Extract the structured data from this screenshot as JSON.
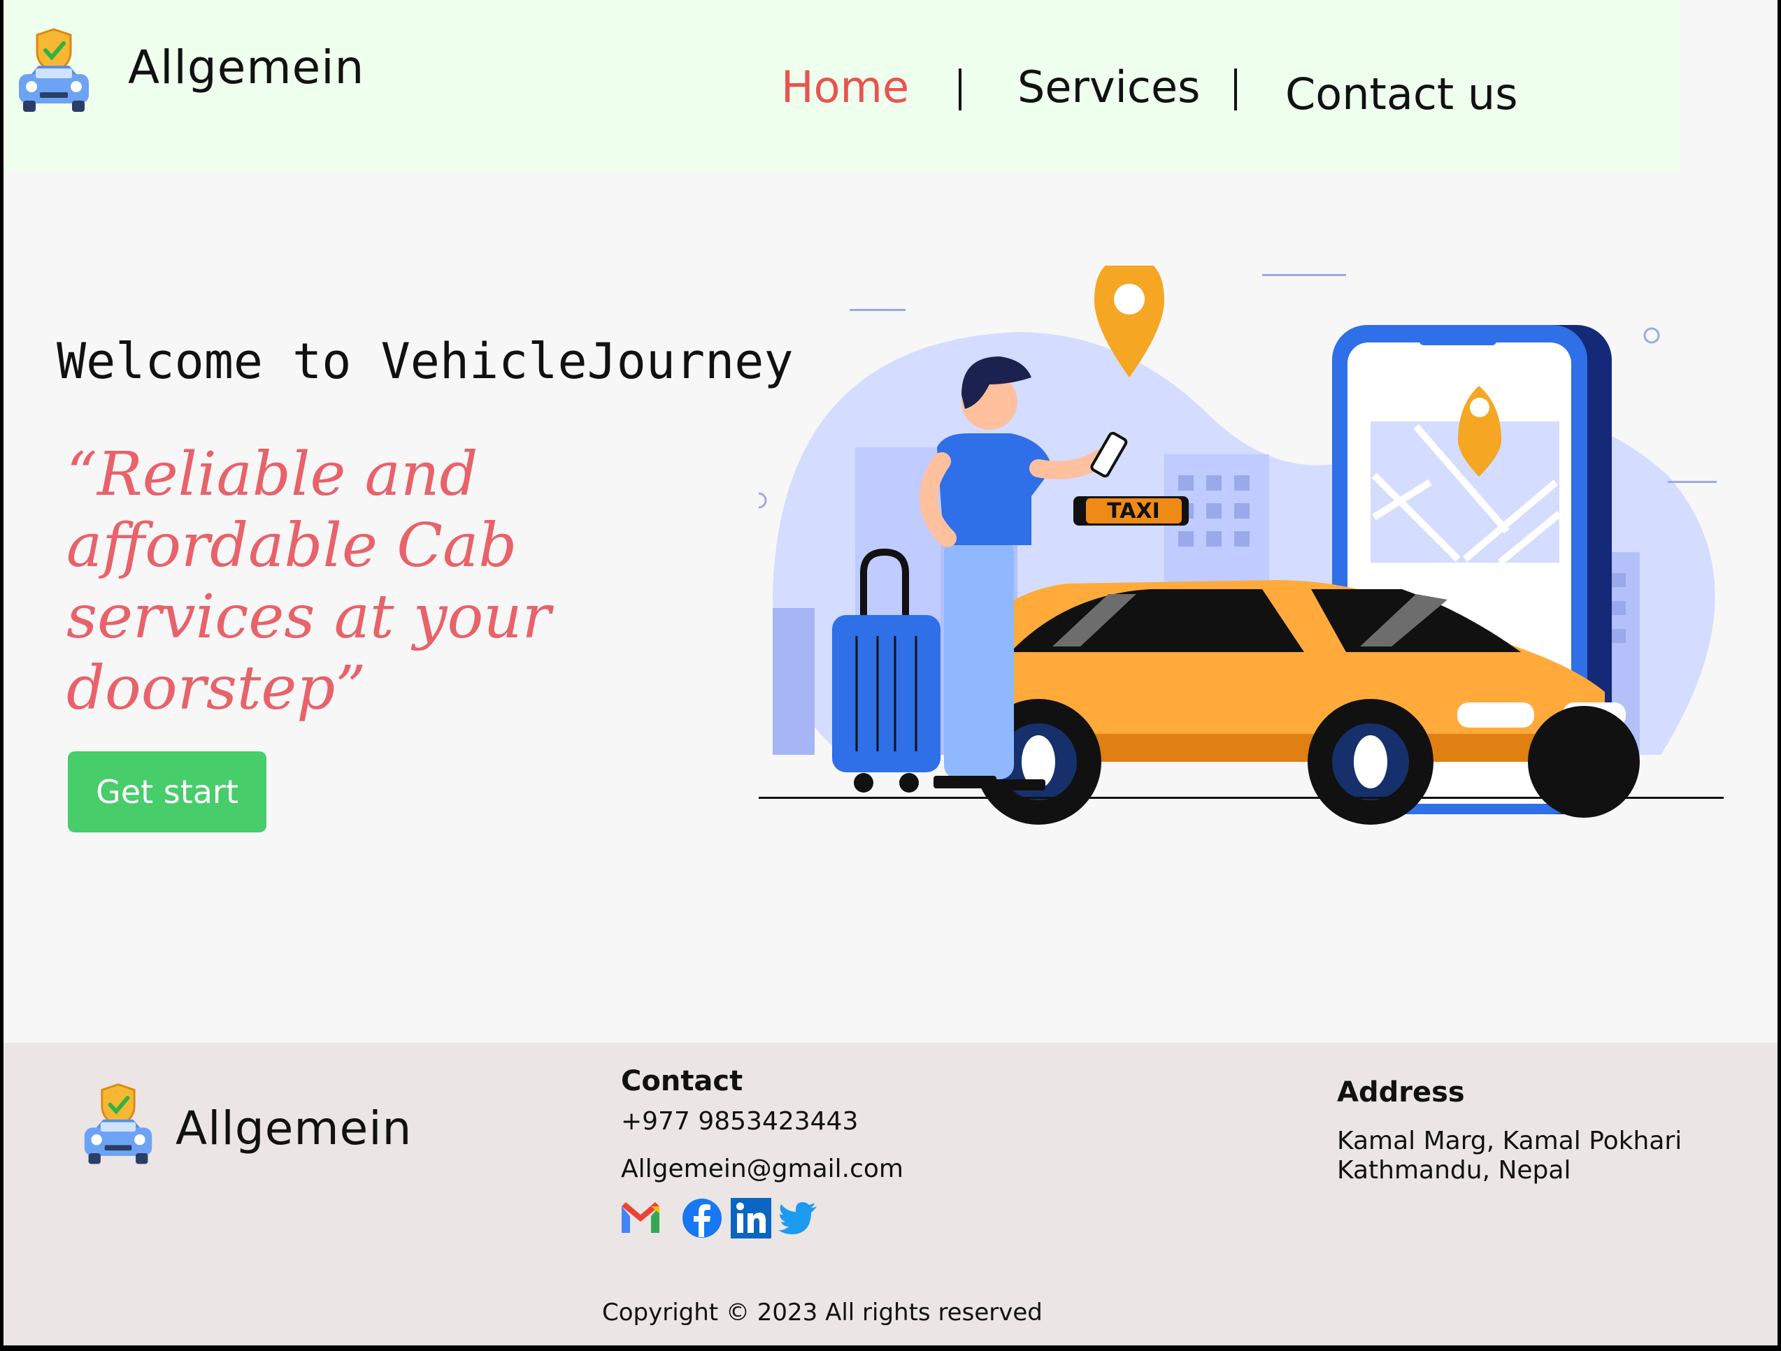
{
  "header": {
    "brand": "Allgemein",
    "nav": [
      {
        "label": "Home",
        "active": true
      },
      {
        "label": "Services",
        "active": false
      },
      {
        "label": "Contact us",
        "active": false
      }
    ]
  },
  "hero": {
    "welcome": "Welcome to VehicleJourney",
    "tagline": "“Reliable and affordable Cab services at your doorstep”",
    "cta_label": "Get start",
    "taxi_sign": "TAXI"
  },
  "footer": {
    "brand": "Allgemein",
    "contact": {
      "heading": "Contact",
      "phone": "+977 9853423443",
      "email": "Allgemein@gmail.com"
    },
    "address": {
      "heading": "Address",
      "line1": "Kamal Marg, Kamal Pokhari",
      "line2": "Kathmandu, Nepal"
    },
    "social_icons": [
      "gmail-icon",
      "facebook-icon",
      "linkedin-icon",
      "twitter-icon"
    ],
    "copyright": "Copyright © 2023 All rights reserved"
  },
  "colors": {
    "header_bg": "#efffee",
    "accent_red": "#e8544f",
    "cta_green": "#47cd6a",
    "footer_bg": "#ebe5e5"
  }
}
